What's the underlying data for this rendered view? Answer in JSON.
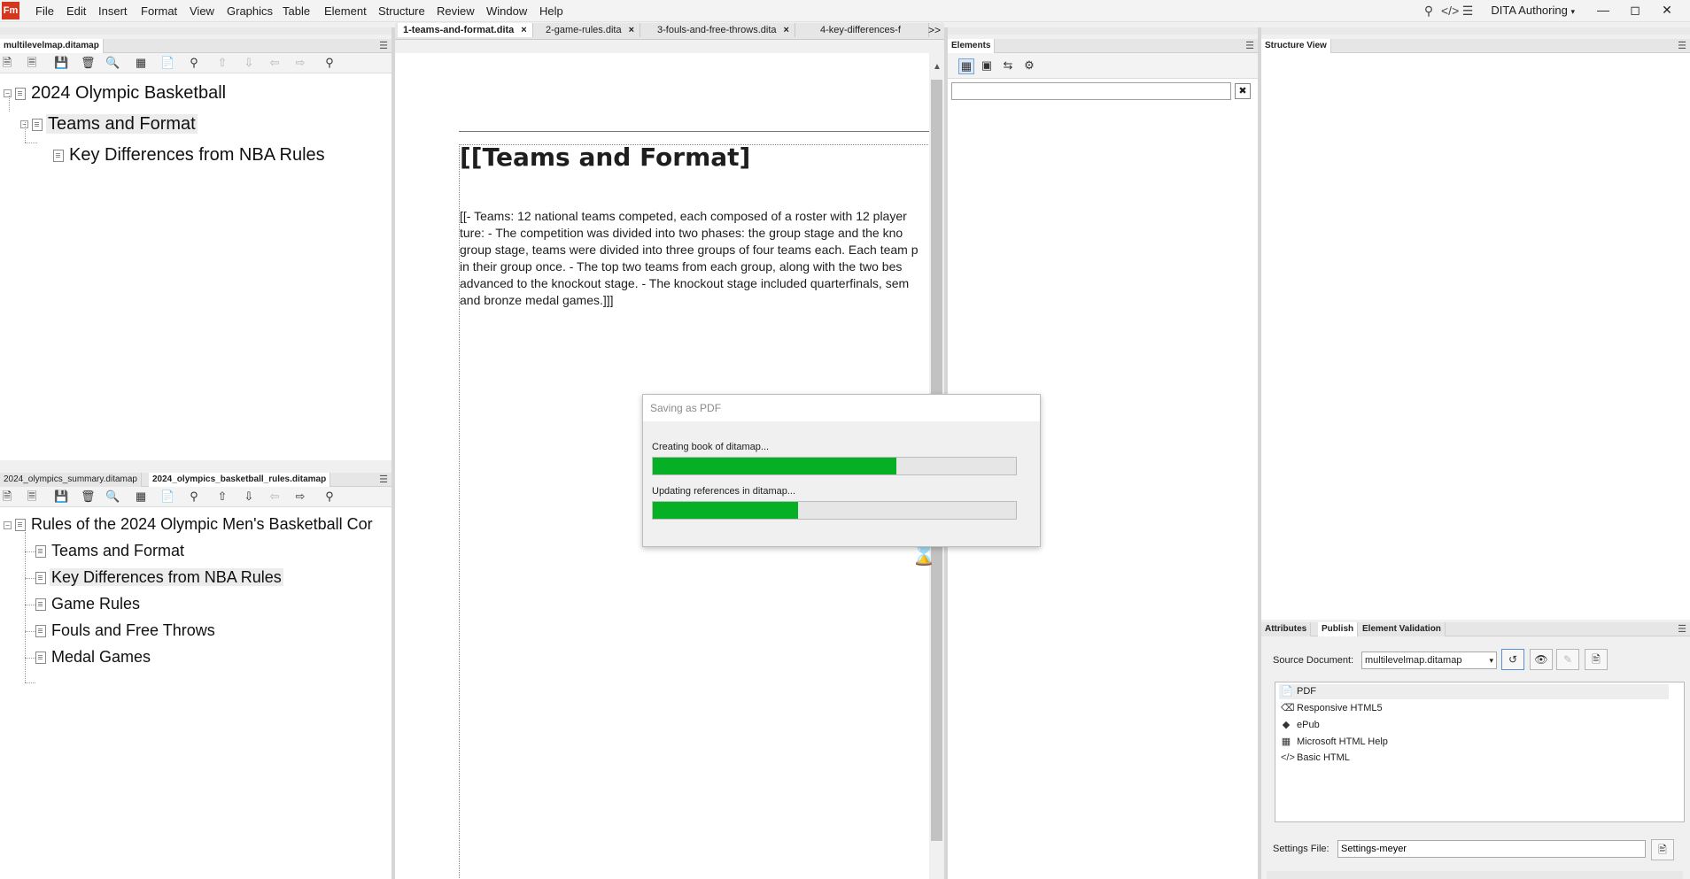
{
  "app": {
    "logo": "Fm",
    "workspace": "DITA Authoring"
  },
  "menu": [
    "File",
    "Edit",
    "Insert",
    "Format",
    "View",
    "Graphics",
    "Table",
    "Element",
    "Structure",
    "Review",
    "Window",
    "Help"
  ],
  "top_map_panel": {
    "tab": "multilevelmap.ditamap",
    "tree": [
      {
        "label": "2024 Olympic Basketball"
      },
      {
        "label": "Teams and Format"
      },
      {
        "label": "Key Differences from NBA Rules"
      }
    ]
  },
  "bottom_map_panel": {
    "tabs": [
      "2024_olympics_summary.ditamap",
      "2024_olympics_basketball_rules.ditamap"
    ],
    "tree": [
      {
        "label": "Rules of the 2024 Olympic Men's Basketball Cor"
      },
      {
        "label": "Teams and Format"
      },
      {
        "label": "Key Differences from NBA Rules"
      },
      {
        "label": "Game Rules"
      },
      {
        "label": "Fouls and Free Throws"
      },
      {
        "label": "Medal Games"
      }
    ]
  },
  "doc_tabs": [
    {
      "label": "1-teams-and-format.dita",
      "close": "×"
    },
    {
      "label": "2-game-rules.dita",
      "close": "×"
    },
    {
      "label": "3-fouls-and-free-throws.dita",
      "close": "×"
    },
    {
      "label": "4-key-differences-f",
      "close": ""
    }
  ],
  "tab_overflow": ">>",
  "document": {
    "heading": "[[Teams and Format]",
    "lines": [
      "[[- Teams: 12 national teams competed, each composed of a roster with 12 player",
      "ture: - The competition was divided into two phases: the group stage and the kno",
      "group stage, teams were divided into three groups of four teams each. Each team p",
      "in their group once. - The top two teams from each group, along with the two bes",
      "advanced to the knockout stage. - The knockout stage included quarterfinals, sem",
      "and bronze medal games.]]]"
    ]
  },
  "dialog": {
    "title": "Saving as PDF",
    "task1": "Creating book of ditamap...",
    "progress1": 0.67,
    "task2": "Updating references in ditamap...",
    "progress2": 0.4
  },
  "elements_panel": {
    "title": "Elements",
    "search_value": ""
  },
  "structure_view": {
    "title": "Structure View"
  },
  "publish_panel": {
    "tabs": [
      "Attributes",
      "Publish",
      "Element Validation"
    ],
    "source_label": "Source Document:",
    "source_value": "multilevelmap.ditamap",
    "outputs": [
      "PDF",
      "Responsive HTML5",
      "ePub",
      "Microsoft HTML Help",
      "Basic HTML"
    ],
    "settings_label": "Settings File:",
    "settings_value": "Settings-meyer"
  },
  "colors": {
    "progress_fill": "#06b025",
    "logo_bg": "#d4361e"
  }
}
